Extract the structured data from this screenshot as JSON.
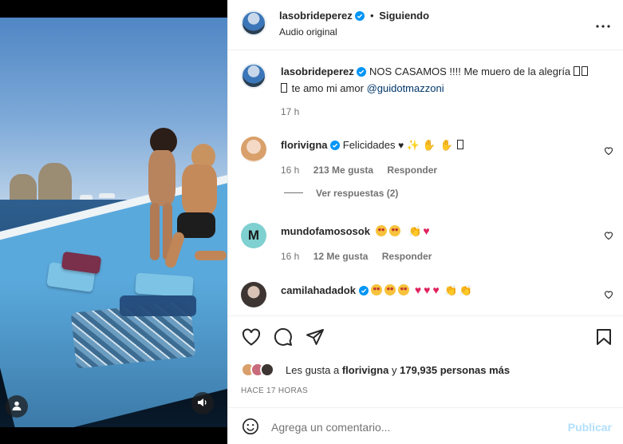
{
  "post": {
    "author": "lasobrideperez",
    "dot": "•",
    "follow_state": "Siguiendo",
    "audio": "Audio original",
    "more_icon": "more-options-icon",
    "caption_text": "NOS CASAMOS !!!! Me muero de la alegría",
    "caption_line2": "te amo mi amor",
    "caption_mention": "@guidotmazzoni",
    "caption_time": "17 h"
  },
  "comments": [
    {
      "user": "florivigna",
      "text": "Felicidades",
      "time": "16 h",
      "likes": "213 Me gusta",
      "reply": "Responder",
      "view_replies": "Ver respuestas (2)"
    },
    {
      "user": "mundofamososok",
      "avatar_letter": "M",
      "time": "16 h",
      "likes": "12 Me gusta",
      "reply": "Responder"
    },
    {
      "user": "camilahadadok"
    }
  ],
  "likes_line": {
    "prefix": "Les gusta a",
    "user": "florivigna",
    "mid": "y",
    "count": "179,935 personas más"
  },
  "timestamp": "HACE 17 HORAS",
  "add_comment": {
    "placeholder": "Agrega un comentario...",
    "post_label": "Publicar"
  },
  "colors": {
    "verified": "#0095f6",
    "link": "#00376b",
    "publish_disabled": "#b2dffc",
    "heart_emoji": "#e0245e"
  },
  "icons": [
    "heart-icon",
    "comment-icon",
    "share-icon",
    "bookmark-icon",
    "emoji-icon",
    "user-tag-icon",
    "sound-icon",
    "verified-badge-icon"
  ]
}
